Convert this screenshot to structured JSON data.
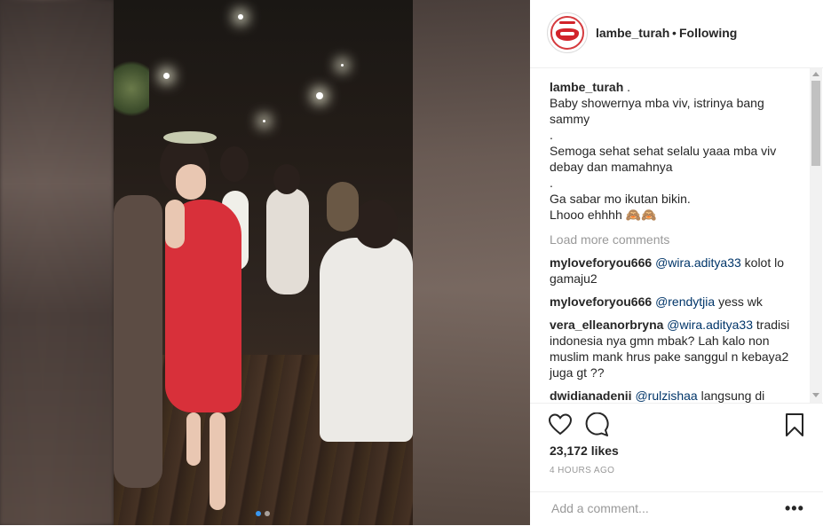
{
  "post": {
    "username": "lambe_turah",
    "separator": "•",
    "follow_status": "Following",
    "caption_user": "lambe_turah",
    "caption_dot": ".",
    "caption_lines": [
      "Baby showernya mba viv, istrinya bang sammy",
      ".",
      "Semoga sehat sehat selalu yaaa mba viv debay dan mamahnya",
      ".",
      "Ga sabar mo ikutan bikin.",
      "Lhooo ehhhh 🙈🙈"
    ],
    "load_more": "Load more comments",
    "comments": [
      {
        "user": "myloveforyou666",
        "mention": "@wira.aditya33",
        "text": "kolot lo gamaju2"
      },
      {
        "user": "myloveforyou666",
        "mention": "@rendytjia",
        "text": "yess wk"
      },
      {
        "user": "vera_elleanorbryna",
        "mention": "@wira.aditya33",
        "text": "tradisi indonesia nya gmn mbak? Lah kalo non muslim mank hrus pake sanggul n kebaya2 juga gt ??"
      },
      {
        "user": "dwidianadenii",
        "mention": "@rulzishaa",
        "text": "langsung di makan aja mb"
      }
    ],
    "likes": "23,172 likes",
    "time_ago": "4 HOURS AGO",
    "add_comment_placeholder": "Add a comment...",
    "more_options": "•••"
  },
  "media": {
    "carousel_pages": 2,
    "active_page": 1
  },
  "icons": {
    "like": "heart-icon",
    "comment": "comment-bubble-icon",
    "save": "bookmark-icon",
    "more": "more-options-icon"
  },
  "colors": {
    "accent": "#3897f0",
    "mention": "#003569",
    "muted": "#999999",
    "text": "#262626"
  }
}
